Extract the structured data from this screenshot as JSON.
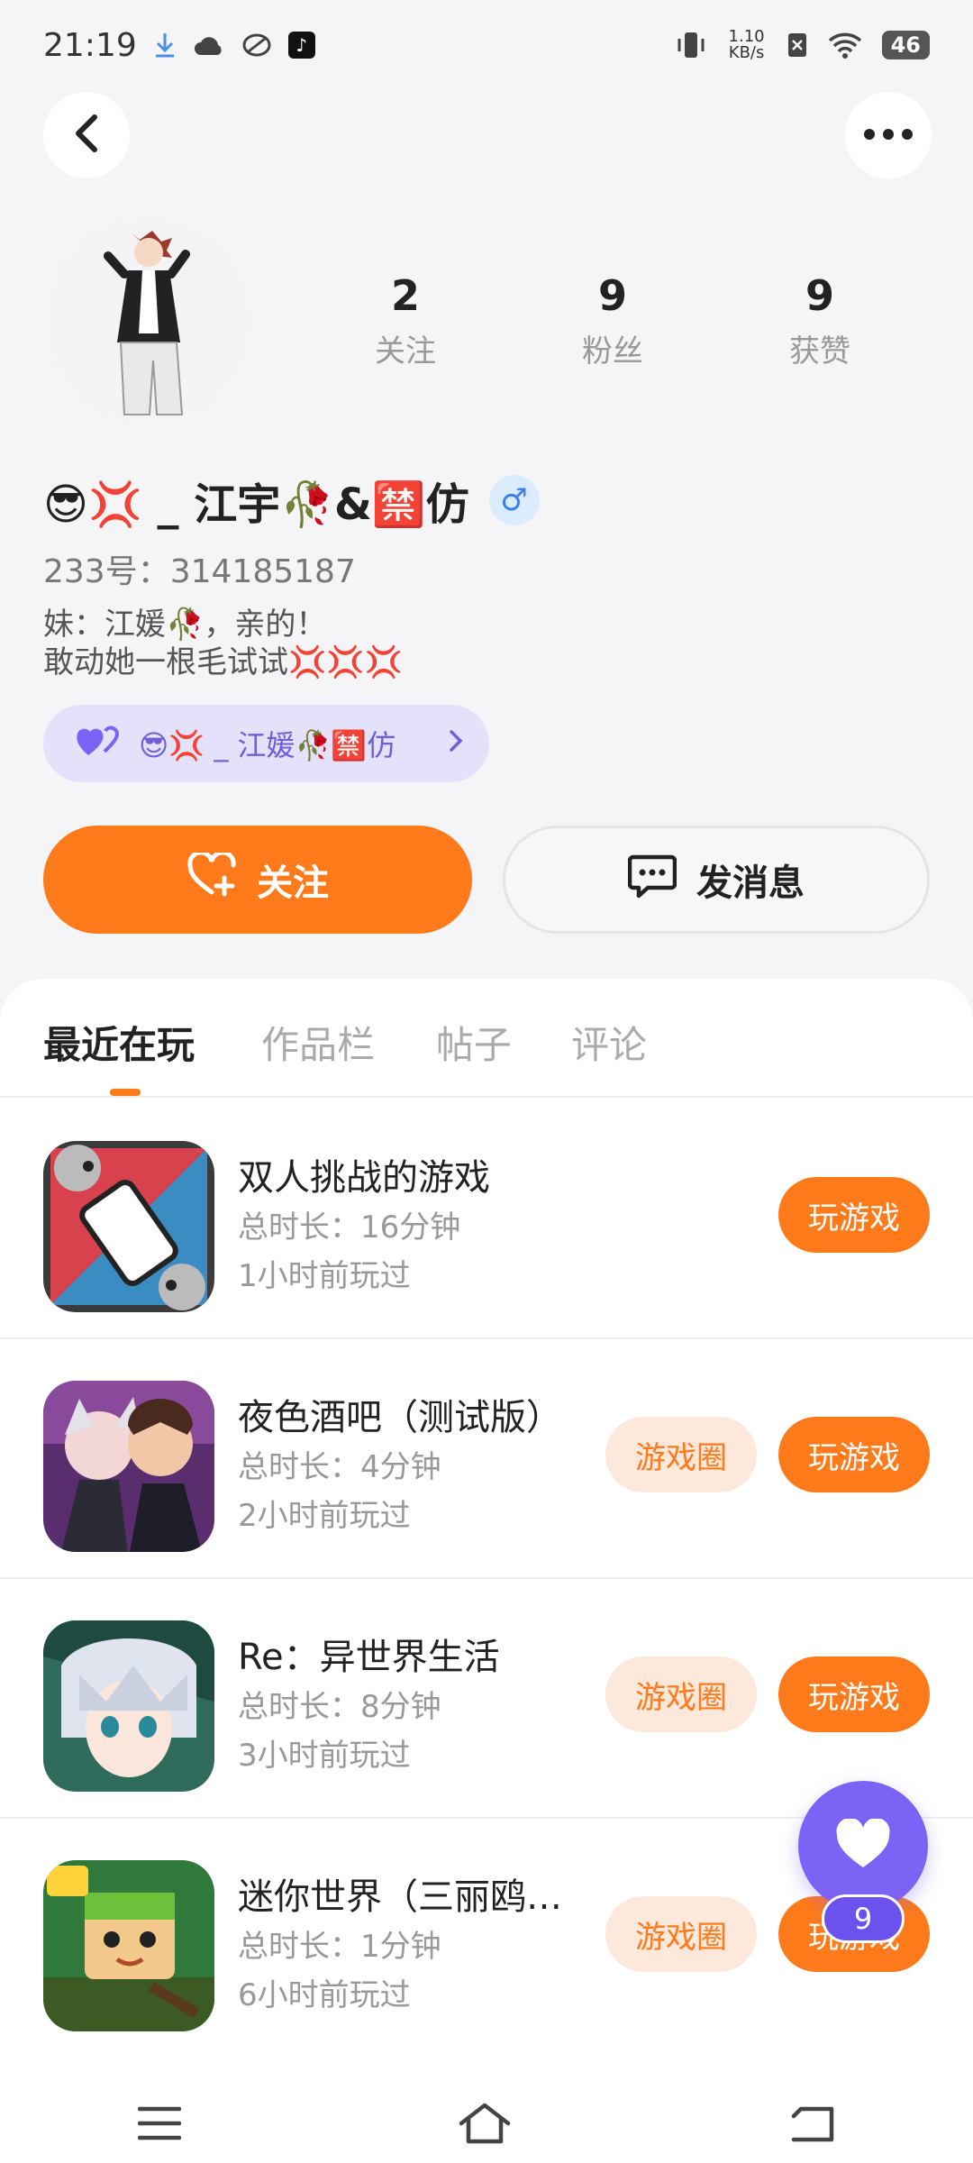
{
  "status_bar": {
    "time": "21:19",
    "net_speed": "1.10 KB/s",
    "battery": "46",
    "icons": [
      "download-icon",
      "cloud-icon",
      "sync-icon",
      "tiktok-icon",
      "vibrate-icon",
      "sim-off-icon",
      "wifi-icon",
      "battery-icon"
    ]
  },
  "nav": {
    "back_icon": "chevron-left-icon",
    "more_icon": "more-dots-icon"
  },
  "profile": {
    "stats": [
      {
        "value": "2",
        "label": "关注"
      },
      {
        "value": "9",
        "label": "粉丝"
      },
      {
        "value": "9",
        "label": "获赞"
      }
    ],
    "nickname": "😎💢 _ 江宇🥀&🈲仿",
    "gender_symbol": "♂",
    "id_line": "233号：314185187",
    "bio_line1": "妹：江媛🥀，亲的！",
    "bio_line2": "敢动她一根毛试试💢💢💢",
    "couple_text": "😎💢 _ 江媛🥀🈲仿"
  },
  "actions": {
    "follow_label": "关注",
    "message_label": "发消息"
  },
  "tabs": [
    "最近在玩",
    "作品栏",
    "帖子",
    "评论"
  ],
  "active_tab": 0,
  "games": [
    {
      "name": "双人挑战的游戏",
      "duration": "总时长：16分钟",
      "last_played": "1小时前玩过",
      "has_circle": false
    },
    {
      "name": "夜色酒吧（测试版）",
      "duration": "总时长：4分钟",
      "last_played": "2小时前玩过",
      "has_circle": true
    },
    {
      "name": "Re：异世界生活",
      "duration": "总时长：8分钟",
      "last_played": "3小时前玩过",
      "has_circle": true
    },
    {
      "name": "迷你世界（三丽鸥…",
      "duration": "总时长：1分钟",
      "last_played": "6小时前玩过",
      "has_circle": true
    }
  ],
  "labels": {
    "play": "玩游戏",
    "circle": "游戏圈"
  },
  "like_fab": {
    "count": "9",
    "icon": "heart-icon"
  },
  "colors": {
    "accent": "#ff7a1a",
    "purple": "#7c63f5",
    "circle_bg": "#fde8dc"
  }
}
